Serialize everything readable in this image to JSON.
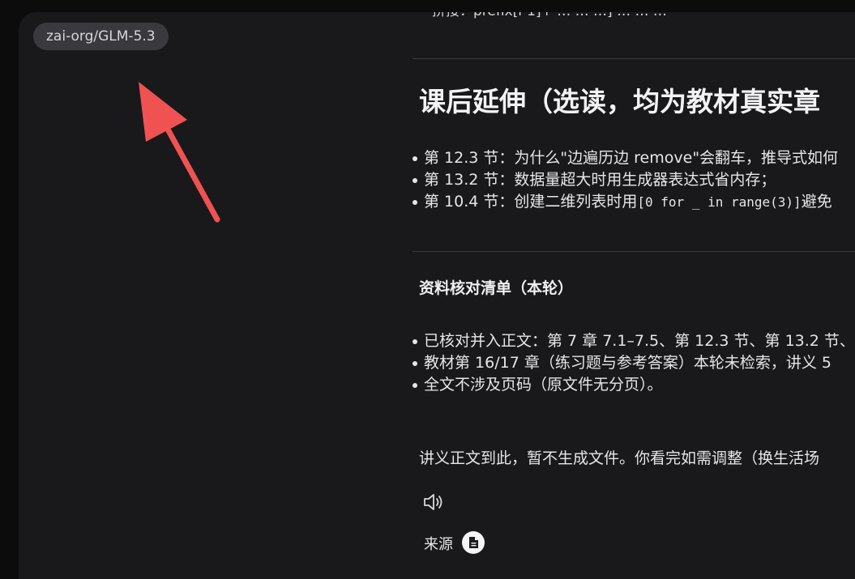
{
  "model_badge": "zai-org/GLM-5.3",
  "content": {
    "clipped_top_line": "拼接：prefix[i-1]+ … …  …]   …  … …",
    "extension_heading": "课后延伸（选读，均为教材真实章",
    "extension_items": [
      {
        "prefix": "第 12.3 节：为什么\"边遍历边 remove\"会翻车，推导式如何"
      },
      {
        "prefix": "第 13.2 节：数据量超大时用生成器表达式省内存；"
      },
      {
        "prefix": "第 10.4 节：创建二维列表时用",
        "code": "[0 for _ in range(3)]",
        "suffix": "避免"
      }
    ],
    "checklist_heading": "资料核对清单（本轮）",
    "checklist_items": [
      "已核对并入正文：第 7 章 7.1–7.5、第 12.3 节、第 13.2 节、",
      "教材第 16/17 章（练习题与参考答案）本轮未检索，讲义 5",
      "全文不涉及页码（原文件无分页）。"
    ],
    "closing_paragraph": "讲义正文到此，暂不生成文件。你看完如需调整（换生活场",
    "source_label": "来源"
  },
  "icons": {
    "speaker": "speaker-icon",
    "source_document": "document-icon"
  },
  "colors": {
    "window_bg": "#19191b",
    "badge_bg": "#3a3a3e",
    "arrow": "#f05252",
    "text": "#e6e6e8"
  }
}
